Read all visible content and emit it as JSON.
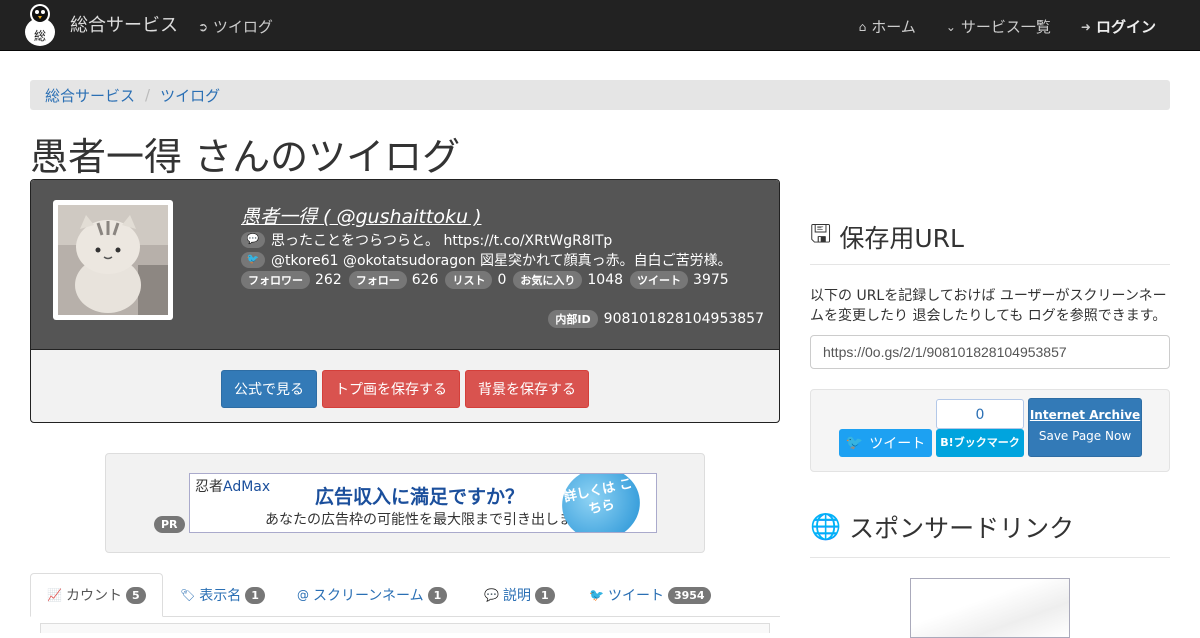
{
  "navbar": {
    "brand": "総合サービス",
    "twilog": "ツイログ",
    "home": "ホーム",
    "services": "サービス一覧",
    "login": "ログイン"
  },
  "breadcrumb": [
    "総合サービス",
    "ツイログ"
  ],
  "title": "愚者一得 さんのツイログ",
  "profile": {
    "name": "愚者一得 ( @gushaittoku )",
    "bio": "思ったことをつらつらと。 https://t.co/XRtWgR8ITp",
    "recent": "@tkore61 @okotatsudoragon 図星突かれて顔真っ赤。自白ご苦労様。",
    "stats": [
      {
        "label": "フォロワー",
        "value": "262"
      },
      {
        "label": "フォロー",
        "value": "626"
      },
      {
        "label": "リスト",
        "value": "0"
      },
      {
        "label": "お気に入り",
        "value": "1048"
      },
      {
        "label": "ツイート",
        "value": "3975"
      }
    ],
    "internal_label": "内部ID",
    "internal_id": "908101828104953857"
  },
  "buttons": {
    "official": "公式で見る",
    "save_icon": "トプ画を保存する",
    "save_bg": "背景を保存する"
  },
  "ad": {
    "pr": "PR",
    "logo_prefix": "忍者",
    "logo_brand": "AdMax",
    "headline": "広告収入に満足ですか？",
    "sub": "あなたの広告枠の可能性を最大限まで引き出します",
    "cta": "詳しくは こちら"
  },
  "tabs": [
    {
      "label": "カウント",
      "count": "5",
      "icon": "chart-icon"
    },
    {
      "label": "表示名",
      "count": "1",
      "icon": "tag-icon"
    },
    {
      "label": "スクリーンネーム",
      "count": "1",
      "icon": "at-icon"
    },
    {
      "label": "説明",
      "count": "1",
      "icon": "comment-icon"
    },
    {
      "label": "ツイート",
      "count": "3954",
      "icon": "twitter-icon"
    }
  ],
  "side": {
    "save_heading": "保存用URL",
    "description": "以下の URLを記録しておけば ユーザーがスクリーンネームを変更したり 退会したりしても ログを参照できます。",
    "url": "https://0o.gs/2/1/908101828104953857",
    "tweet": "ツイート",
    "hatena_count": "0",
    "hatena": "B!ブックマーク",
    "ia_title": "Internet Archive",
    "ia_action": "Save Page Now",
    "sponsor_heading": "スポンサードリンク"
  }
}
